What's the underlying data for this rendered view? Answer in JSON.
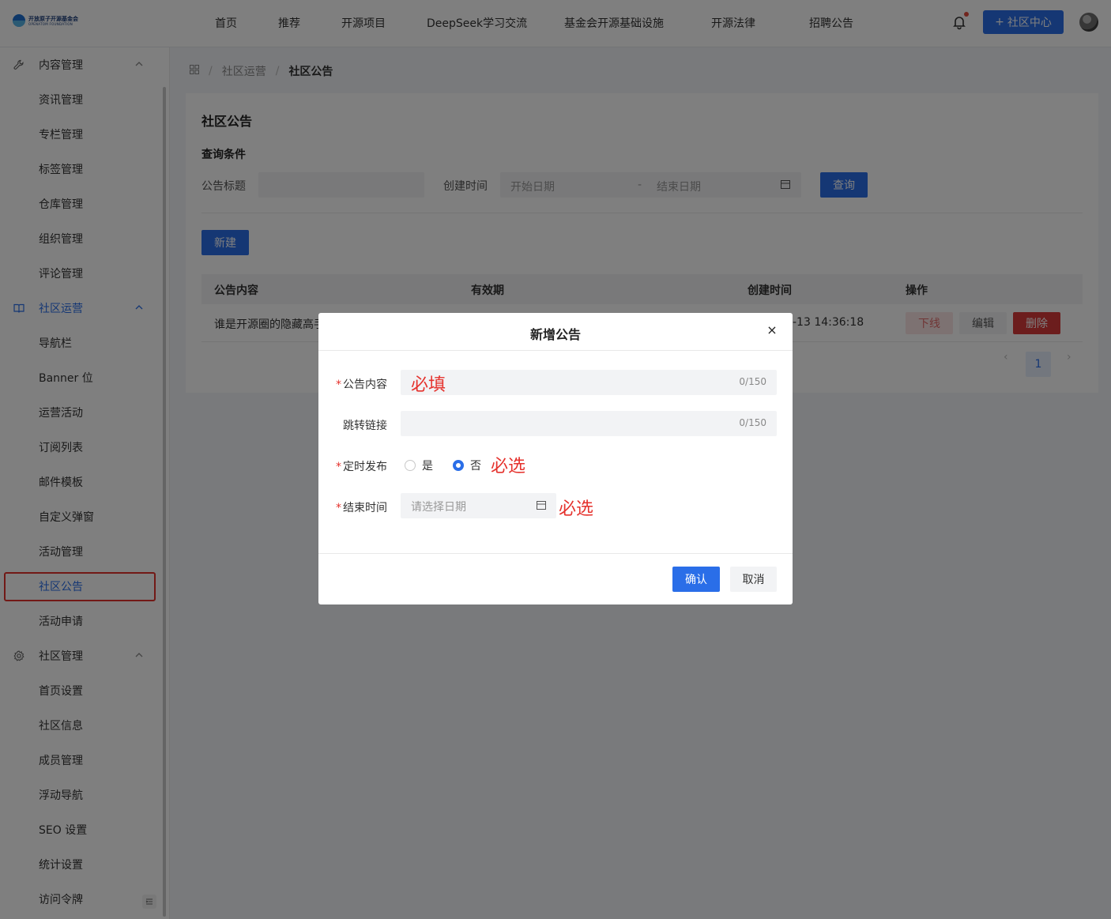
{
  "logo": {
    "line1": "开放原子开源基金会",
    "line2": "OPENATOM FOUNDATION"
  },
  "nav": {
    "items": [
      "首页",
      "推荐",
      "开源项目",
      "DeepSeek学习交流",
      "基金会开源基础设施",
      "开源法律",
      "招聘公告"
    ],
    "community_button": "社区中心"
  },
  "sidebar": {
    "groups": [
      {
        "label": "内容管理",
        "icon": "wrench-icon",
        "items": [
          "资讯管理",
          "专栏管理",
          "标签管理",
          "仓库管理",
          "组织管理",
          "评论管理"
        ]
      },
      {
        "label": "社区运营",
        "icon": "book-icon",
        "items": [
          "导航栏",
          "Banner 位",
          "运营活动",
          "订阅列表",
          "邮件模板",
          "自定义弹窗",
          "活动管理",
          "社区公告",
          "活动申请"
        ]
      },
      {
        "label": "社区管理",
        "icon": "gear-icon",
        "items": [
          "首页设置",
          "社区信息",
          "成员管理",
          "浮动导航",
          "SEO 设置",
          "统计设置",
          "访问令牌"
        ]
      }
    ],
    "active_item": "社区公告"
  },
  "breadcrumb": {
    "level1": "社区运营",
    "level2": "社区公告"
  },
  "page": {
    "title": "社区公告",
    "query_title": "查询条件",
    "title_filter_label": "公告标题",
    "created_time_label": "创建时间",
    "start_placeholder": "开始日期",
    "range_sep": "-",
    "end_placeholder": "结束日期",
    "query_button": "查询",
    "new_button": "新建"
  },
  "table": {
    "columns": [
      "公告内容",
      "有效期",
      "创建时间",
      "操作"
    ],
    "rows": [
      {
        "content": "谁是开源圈的隐藏高手",
        "created": "-13 14:36:18"
      }
    ],
    "actions": {
      "offline": "下线",
      "edit": "编辑",
      "delete": "删除"
    }
  },
  "pagination": {
    "prev": "‹",
    "current": "1",
    "next": "›"
  },
  "modal": {
    "title": "新增公告",
    "close": "×",
    "fields": {
      "content_label": "公告内容",
      "content_count": "0/150",
      "link_label": "跳转链接",
      "link_count": "0/150",
      "schedule_label": "定时发布",
      "schedule_yes": "是",
      "schedule_no": "否",
      "end_time_label": "结束时间",
      "end_time_placeholder": "请选择日期"
    },
    "required_mark": "*",
    "confirm": "确认",
    "cancel": "取消"
  },
  "annotations": {
    "required_fill": "必填",
    "required_select_1": "必选",
    "required_select_2": "必选"
  },
  "colors": {
    "primary": "#2a6ee8",
    "danger": "#d93b3b",
    "annotation": "#e5322d"
  }
}
